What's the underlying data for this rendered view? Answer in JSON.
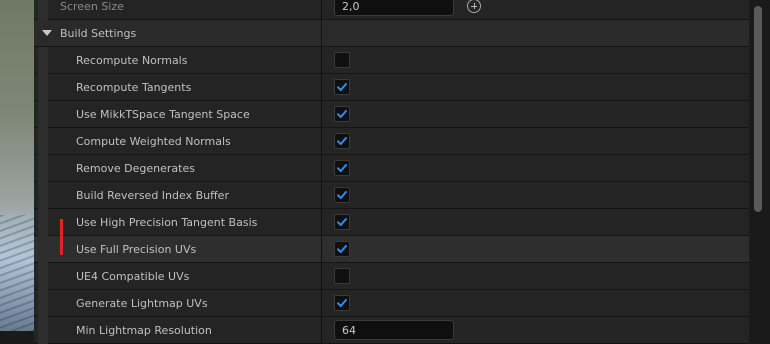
{
  "top_row": {
    "label": "Screen Size",
    "value": "2,0"
  },
  "section": {
    "label": "Build Settings"
  },
  "properties": [
    {
      "label": "Recompute Normals",
      "checked": false
    },
    {
      "label": "Recompute Tangents",
      "checked": true
    },
    {
      "label": "Use MikkTSpace Tangent Space",
      "checked": true
    },
    {
      "label": "Compute Weighted Normals",
      "checked": true
    },
    {
      "label": "Remove Degenerates",
      "checked": true
    },
    {
      "label": "Build Reversed Index Buffer",
      "checked": true
    },
    {
      "label": "Use High Precision Tangent Basis",
      "checked": true
    },
    {
      "label": "Use Full Precision UVs",
      "checked": true
    },
    {
      "label": "UE4 Compatible UVs",
      "checked": false
    },
    {
      "label": "Generate Lightmap UVs",
      "checked": true
    }
  ],
  "bottom_row": {
    "label": "Min Lightmap Resolution",
    "value": "64"
  },
  "colors": {
    "check": "#2f8ff0",
    "marker": "#e0222a"
  },
  "icons": {
    "add": "plus-circle-icon",
    "expand": "caret-down-icon",
    "check": "checkmark-icon"
  }
}
